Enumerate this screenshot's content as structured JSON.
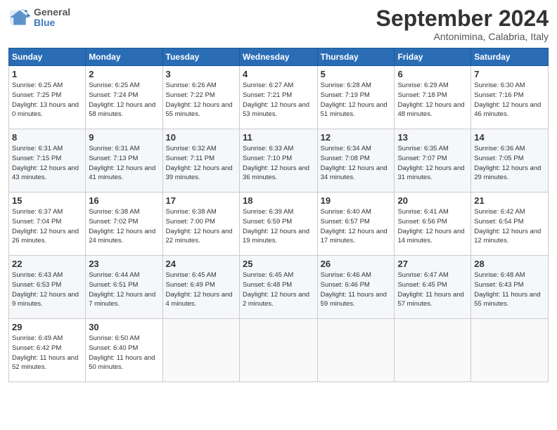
{
  "header": {
    "logo_line1": "General",
    "logo_line2": "Blue",
    "month": "September 2024",
    "location": "Antonimina, Calabria, Italy"
  },
  "days_of_week": [
    "Sunday",
    "Monday",
    "Tuesday",
    "Wednesday",
    "Thursday",
    "Friday",
    "Saturday"
  ],
  "weeks": [
    [
      {
        "day": "1",
        "sunrise": "6:25 AM",
        "sunset": "7:25 PM",
        "daylight": "13 hours and 0 minutes."
      },
      {
        "day": "2",
        "sunrise": "6:25 AM",
        "sunset": "7:24 PM",
        "daylight": "12 hours and 58 minutes."
      },
      {
        "day": "3",
        "sunrise": "6:26 AM",
        "sunset": "7:22 PM",
        "daylight": "12 hours and 55 minutes."
      },
      {
        "day": "4",
        "sunrise": "6:27 AM",
        "sunset": "7:21 PM",
        "daylight": "12 hours and 53 minutes."
      },
      {
        "day": "5",
        "sunrise": "6:28 AM",
        "sunset": "7:19 PM",
        "daylight": "12 hours and 51 minutes."
      },
      {
        "day": "6",
        "sunrise": "6:29 AM",
        "sunset": "7:18 PM",
        "daylight": "12 hours and 48 minutes."
      },
      {
        "day": "7",
        "sunrise": "6:30 AM",
        "sunset": "7:16 PM",
        "daylight": "12 hours and 46 minutes."
      }
    ],
    [
      {
        "day": "8",
        "sunrise": "6:31 AM",
        "sunset": "7:15 PM",
        "daylight": "12 hours and 43 minutes."
      },
      {
        "day": "9",
        "sunrise": "6:31 AM",
        "sunset": "7:13 PM",
        "daylight": "12 hours and 41 minutes."
      },
      {
        "day": "10",
        "sunrise": "6:32 AM",
        "sunset": "7:11 PM",
        "daylight": "12 hours and 39 minutes."
      },
      {
        "day": "11",
        "sunrise": "6:33 AM",
        "sunset": "7:10 PM",
        "daylight": "12 hours and 36 minutes."
      },
      {
        "day": "12",
        "sunrise": "6:34 AM",
        "sunset": "7:08 PM",
        "daylight": "12 hours and 34 minutes."
      },
      {
        "day": "13",
        "sunrise": "6:35 AM",
        "sunset": "7:07 PM",
        "daylight": "12 hours and 31 minutes."
      },
      {
        "day": "14",
        "sunrise": "6:36 AM",
        "sunset": "7:05 PM",
        "daylight": "12 hours and 29 minutes."
      }
    ],
    [
      {
        "day": "15",
        "sunrise": "6:37 AM",
        "sunset": "7:04 PM",
        "daylight": "12 hours and 26 minutes."
      },
      {
        "day": "16",
        "sunrise": "6:38 AM",
        "sunset": "7:02 PM",
        "daylight": "12 hours and 24 minutes."
      },
      {
        "day": "17",
        "sunrise": "6:38 AM",
        "sunset": "7:00 PM",
        "daylight": "12 hours and 22 minutes."
      },
      {
        "day": "18",
        "sunrise": "6:39 AM",
        "sunset": "6:59 PM",
        "daylight": "12 hours and 19 minutes."
      },
      {
        "day": "19",
        "sunrise": "6:40 AM",
        "sunset": "6:57 PM",
        "daylight": "12 hours and 17 minutes."
      },
      {
        "day": "20",
        "sunrise": "6:41 AM",
        "sunset": "6:56 PM",
        "daylight": "12 hours and 14 minutes."
      },
      {
        "day": "21",
        "sunrise": "6:42 AM",
        "sunset": "6:54 PM",
        "daylight": "12 hours and 12 minutes."
      }
    ],
    [
      {
        "day": "22",
        "sunrise": "6:43 AM",
        "sunset": "6:53 PM",
        "daylight": "12 hours and 9 minutes."
      },
      {
        "day": "23",
        "sunrise": "6:44 AM",
        "sunset": "6:51 PM",
        "daylight": "12 hours and 7 minutes."
      },
      {
        "day": "24",
        "sunrise": "6:45 AM",
        "sunset": "6:49 PM",
        "daylight": "12 hours and 4 minutes."
      },
      {
        "day": "25",
        "sunrise": "6:45 AM",
        "sunset": "6:48 PM",
        "daylight": "12 hours and 2 minutes."
      },
      {
        "day": "26",
        "sunrise": "6:46 AM",
        "sunset": "6:46 PM",
        "daylight": "11 hours and 59 minutes."
      },
      {
        "day": "27",
        "sunrise": "6:47 AM",
        "sunset": "6:45 PM",
        "daylight": "11 hours and 57 minutes."
      },
      {
        "day": "28",
        "sunrise": "6:48 AM",
        "sunset": "6:43 PM",
        "daylight": "11 hours and 55 minutes."
      }
    ],
    [
      {
        "day": "29",
        "sunrise": "6:49 AM",
        "sunset": "6:42 PM",
        "daylight": "11 hours and 52 minutes."
      },
      {
        "day": "30",
        "sunrise": "6:50 AM",
        "sunset": "6:40 PM",
        "daylight": "11 hours and 50 minutes."
      },
      null,
      null,
      null,
      null,
      null
    ]
  ]
}
